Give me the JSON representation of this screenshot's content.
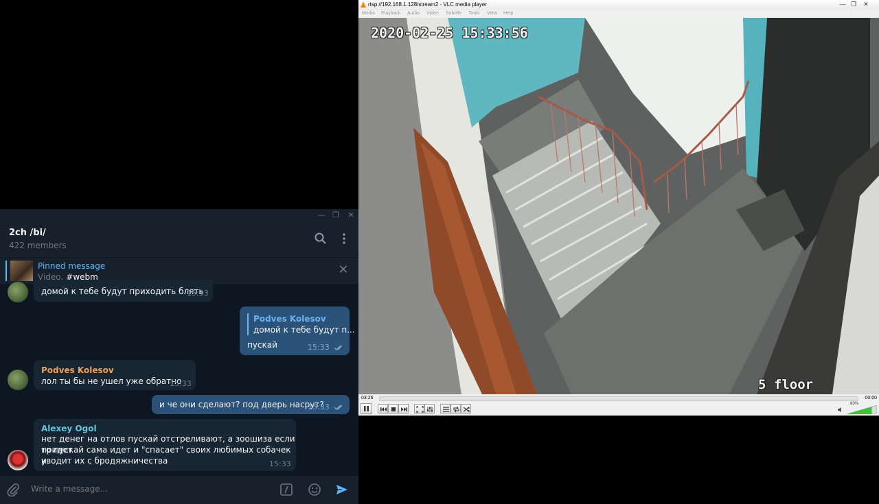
{
  "telegram": {
    "chat_title": "2ch /bi/",
    "members": "422 members",
    "pinned": {
      "title": "Pinned message",
      "type": "Video,",
      "tag": "#webm"
    },
    "messages": [
      {
        "id": "m1",
        "text": "домой к тебе будут приходить блять",
        "time": "15:33"
      },
      {
        "id": "m2",
        "reply_name": "Podves Kolesov",
        "reply_text": "домой к тебе будут п...",
        "text": "пускай",
        "time": "15:33"
      },
      {
        "id": "m3",
        "sender": "Podves Kolesov",
        "text": "лол ты бы не ушел уже обратно",
        "time": "15:33"
      },
      {
        "id": "m4",
        "text": "и че они сделают? под дверь насрут?",
        "time": "15:33"
      },
      {
        "id": "m5",
        "sender": "Alexey Ogol",
        "lines": [
          "нет денег на отлов пускай отстреливают, а зоошиза если придет",
          "то пускай сама идет и \"спасает\" своих любимых собачек и",
          "уводит их с бродяжничества"
        ],
        "time": "15:33"
      }
    ],
    "composer_placeholder": "Write a message...",
    "colors": {
      "accent": "#5eb5f7",
      "orange_name": "#e9a15a",
      "cyan_name": "#65c5db"
    }
  },
  "vlc": {
    "window_title": "rtsp://192.168.1.128/stream2 - VLC media player",
    "menu": [
      "Media",
      "Playback",
      "Audio",
      "Video",
      "Subtitle",
      "Tools",
      "View",
      "Help"
    ],
    "osd_timestamp": "2020-02-25 15:33:56",
    "osd_floor": "5 floor",
    "time_elapsed": "03:26",
    "time_total": "00:00",
    "volume": "83%"
  }
}
